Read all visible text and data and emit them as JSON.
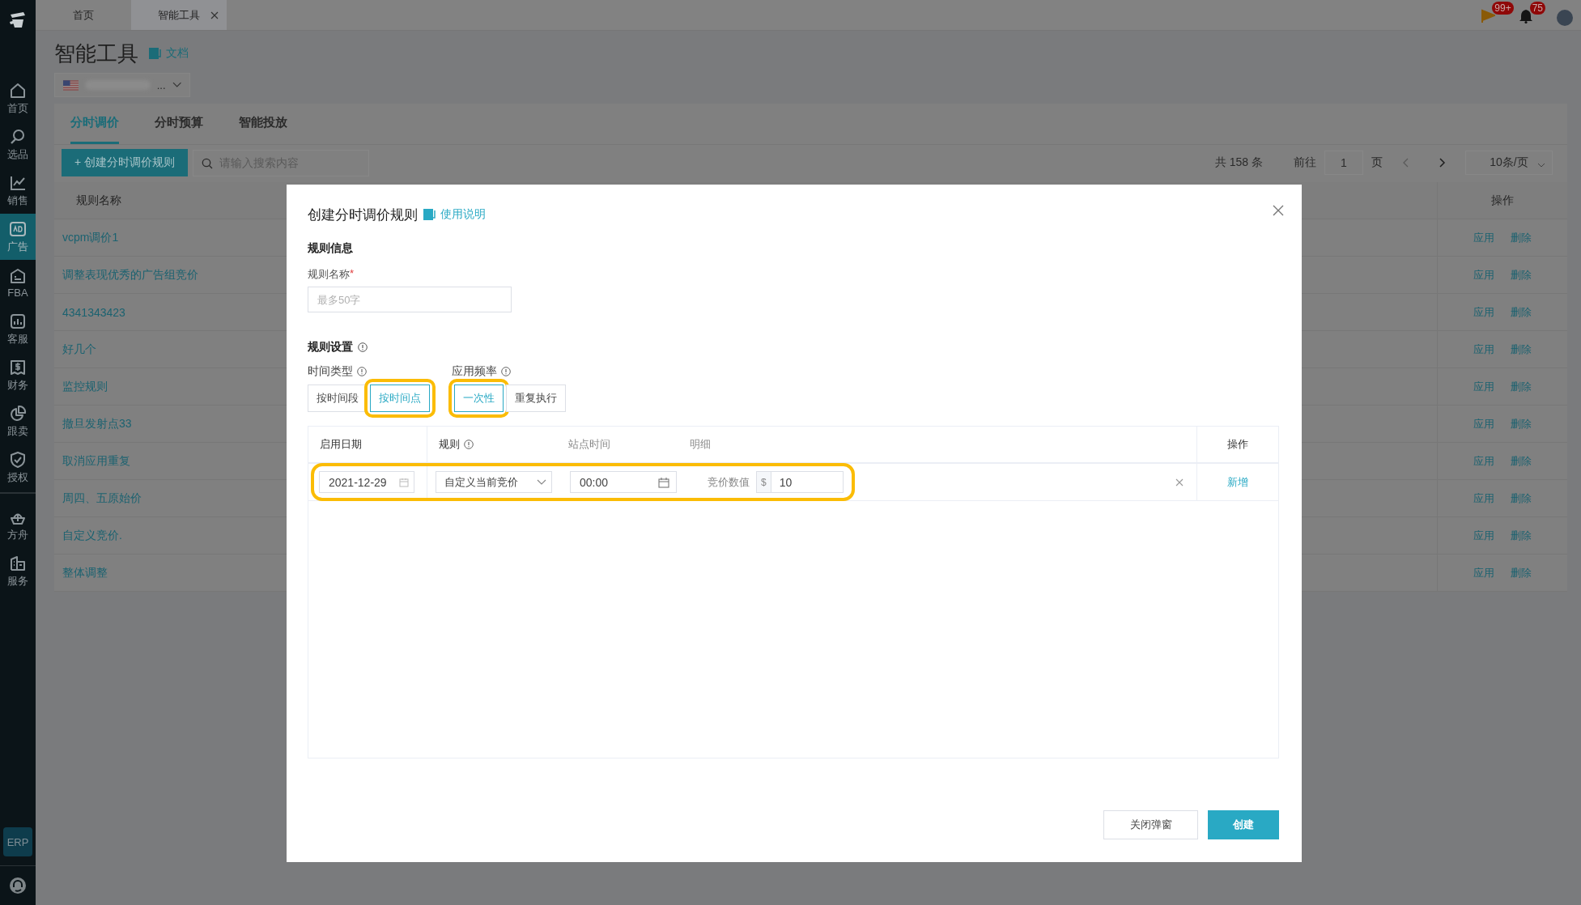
{
  "tab_bar": {
    "tabs": [
      {
        "label": "首页",
        "selected": false,
        "closable": false
      },
      {
        "label": "智能工具",
        "selected": true,
        "closable": true
      }
    ]
  },
  "header": {
    "badges": [
      {
        "kind": "flag",
        "count": "99+"
      },
      {
        "kind": "bell",
        "count": "75"
      }
    ]
  },
  "sidebar": {
    "items": [
      {
        "label": "首页",
        "selected": false
      },
      {
        "label": "选品",
        "selected": false
      },
      {
        "label": "销售",
        "selected": false
      },
      {
        "label": "广告",
        "selected": true
      },
      {
        "label": "FBA",
        "selected": false
      },
      {
        "label": "客服",
        "selected": false
      },
      {
        "label": "财务",
        "selected": false
      },
      {
        "label": "跟卖",
        "selected": false
      },
      {
        "label": "授权",
        "selected": false
      }
    ],
    "secondary_items": [
      {
        "label": "方舟",
        "selected": false
      },
      {
        "label": "服务",
        "selected": false
      }
    ],
    "erp_button": "ERP"
  },
  "page": {
    "title": "智能工具",
    "doc_link": "文档",
    "account_suffix": "..."
  },
  "subtabs": [
    {
      "label": "分时调价",
      "selected": true
    },
    {
      "label": "分时预算",
      "selected": false
    },
    {
      "label": "智能投放",
      "selected": false
    }
  ],
  "toolbar": {
    "create_button": "+ 创建分时调价规则",
    "search_placeholder": "请输入搜索内容"
  },
  "pagination": {
    "total": "共 158 条",
    "goto_label": "前往",
    "page": "1",
    "page_unit": "页",
    "page_size": "10条/页"
  },
  "table": {
    "columns": [
      "规则名称",
      "操作"
    ],
    "rows": [
      {
        "name": "vcpm调价1",
        "actions": [
          "应用",
          "删除"
        ]
      },
      {
        "name": "调整表现优秀的广告组竞价",
        "actions": [
          "应用",
          "删除"
        ]
      },
      {
        "name": "4341343423",
        "actions": [
          "应用",
          "删除"
        ]
      },
      {
        "name": "好几个",
        "actions": [
          "应用",
          "删除"
        ]
      },
      {
        "name": "监控规则",
        "actions": [
          "应用",
          "删除"
        ]
      },
      {
        "name": "撤旦发射点33",
        "actions": [
          "应用",
          "删除"
        ]
      },
      {
        "name": "取消应用重复",
        "actions": [
          "应用",
          "删除"
        ]
      },
      {
        "name": "周四、五原始价",
        "actions": [
          "应用",
          "删除"
        ]
      },
      {
        "name": "自定义竞价.",
        "actions": [
          "应用",
          "删除"
        ]
      },
      {
        "name": "整体调整",
        "actions": [
          "应用",
          "删除"
        ]
      }
    ]
  },
  "modal": {
    "title": "创建分时调价规则",
    "help_link": "使用说明",
    "section_info": "规则信息",
    "name_label": "规则名称",
    "name_required_mark": "*",
    "name_placeholder": "最多50字",
    "section_settings": "规则设置",
    "option_groups": [
      {
        "label": "时间类型",
        "options": [
          {
            "label": "按时间段",
            "selected": false,
            "highlighted": false
          },
          {
            "label": "按时间点",
            "selected": true,
            "highlighted": true
          }
        ]
      },
      {
        "label": "应用频率",
        "options": [
          {
            "label": "一次性",
            "selected": true,
            "highlighted": true
          },
          {
            "label": "重复执行",
            "selected": false,
            "highlighted": false
          }
        ]
      }
    ],
    "schedule": {
      "columns": [
        {
          "label": "启用日期",
          "info": false
        },
        {
          "label": "规则",
          "info": true
        },
        {
          "label": "站点时间",
          "info": false
        },
        {
          "label": "明细",
          "info": false
        },
        {
          "label": "操作",
          "info": false
        }
      ],
      "rows": [
        {
          "date": "2021-12-29",
          "rule": "自定义当前竞价",
          "time": "00:00",
          "detail_label": "竞价数值",
          "currency": "$",
          "value": "10",
          "action": "新增",
          "highlighted": true
        }
      ]
    },
    "buttons": [
      {
        "label": "关闭弹窗",
        "kind": "secondary"
      },
      {
        "label": "创建",
        "kind": "primary"
      }
    ]
  }
}
